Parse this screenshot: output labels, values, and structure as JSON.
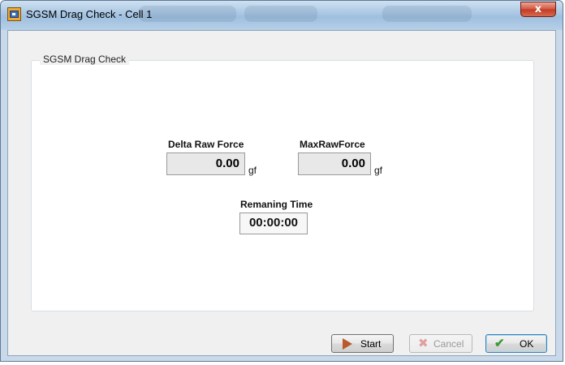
{
  "window": {
    "title": "SGSM Drag Check - Cell 1",
    "close_glyph": "x",
    "icon": "app-icon"
  },
  "group": {
    "label": "SGSM Drag Check"
  },
  "fields": {
    "delta_raw_force": {
      "label": "Delta Raw Force",
      "value": "0.00",
      "unit": "gf"
    },
    "max_raw_force": {
      "label": "MaxRawForce",
      "value": "0.00",
      "unit": "gf"
    },
    "remaining_time": {
      "label": "Remaning Time",
      "value": "00:00:00"
    }
  },
  "buttons": {
    "start": {
      "label": "Start",
      "icon": "play-icon",
      "enabled": true
    },
    "cancel": {
      "label": "Cancel",
      "icon": "x-icon",
      "enabled": false
    },
    "ok": {
      "label": "OK",
      "icon": "check-icon",
      "enabled": true
    }
  },
  "colors": {
    "titlebar": "#a9c6e3",
    "close_button": "#c8452e",
    "start_icon": "#b85a2a",
    "ok_icon": "#3a9a3a"
  }
}
